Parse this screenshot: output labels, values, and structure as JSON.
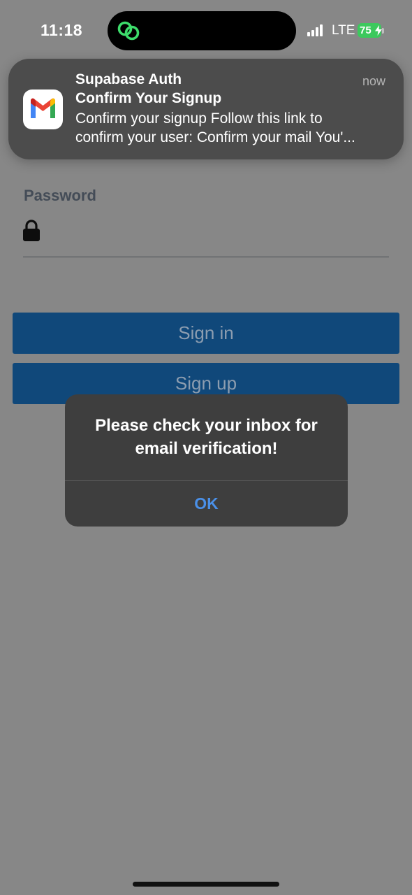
{
  "status_bar": {
    "time": "11:18",
    "network": "LTE",
    "battery": "75",
    "battery_color": "#3cc95d"
  },
  "notification": {
    "app_name": "Supabase Auth",
    "time": "now",
    "subject": "Confirm Your Signup",
    "body_line1": "Confirm your signup Follow this link to",
    "body_line2": "confirm your user: Confirm your mail You'...",
    "icon": "gmail-icon"
  },
  "form": {
    "password_label": "Password",
    "password_value": "",
    "signin_label": "Sign in",
    "signup_label": "Sign up",
    "button_color": "#10487a"
  },
  "alert": {
    "message_line1": "Please check your inbox for",
    "message_line2": "email verification!",
    "ok_label": "OK",
    "ok_color": "#4a90e8"
  }
}
